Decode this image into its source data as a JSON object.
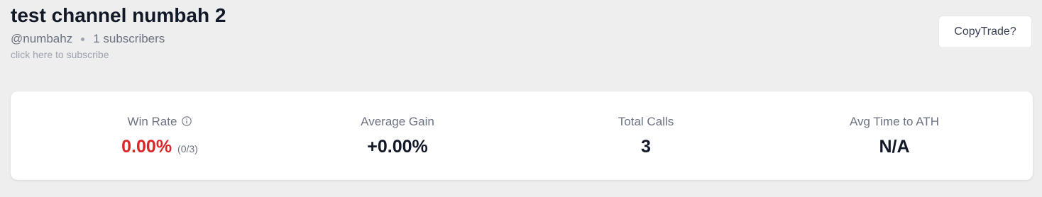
{
  "channel": {
    "title": "test channel numbah 2",
    "handle": "@numbahz",
    "subscribers": "1 subscribers",
    "subscribe_link": "click here to subscribe"
  },
  "actions": {
    "copytrade_label": "CopyTrade?"
  },
  "stats": {
    "win_rate": {
      "label": "Win Rate",
      "value": "0.00%",
      "sub": "(0/3)",
      "icon": "info-icon",
      "value_color": "#dc2626"
    },
    "average_gain": {
      "label": "Average Gain",
      "value": "+0.00%"
    },
    "total_calls": {
      "label": "Total Calls",
      "value": "3"
    },
    "avg_time_to_ath": {
      "label": "Avg Time to ATH",
      "value": "N/A"
    }
  }
}
